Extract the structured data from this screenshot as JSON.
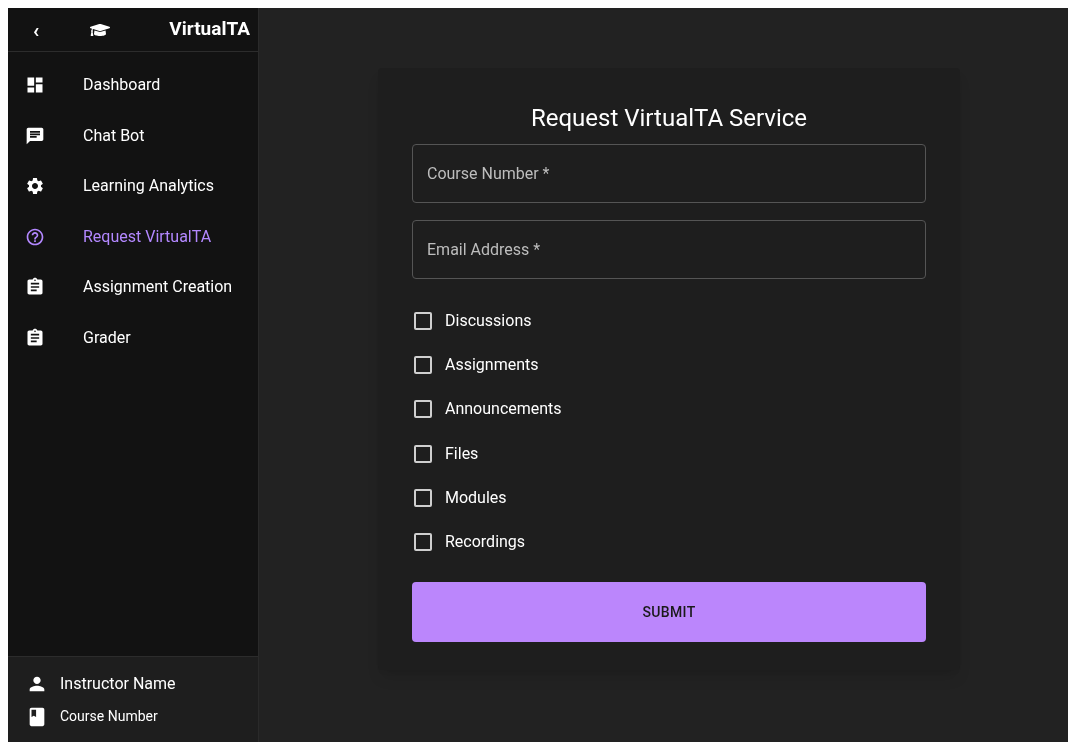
{
  "sidebar": {
    "collapse_button": "‹",
    "brand": "VirtualTA",
    "items": [
      {
        "label": "Dashboard",
        "selected": false
      },
      {
        "label": "Chat Bot",
        "selected": false
      },
      {
        "label": "Learning Analytics",
        "selected": false
      },
      {
        "label": "Request VirtualTA",
        "selected": true
      },
      {
        "label": "Assignment Creation",
        "selected": false
      },
      {
        "label": "Grader",
        "selected": false
      }
    ],
    "footer": {
      "user": "Instructor Name",
      "course": "Course Number"
    }
  },
  "form": {
    "title": "Request VirtualTA Service",
    "fields": [
      {
        "placeholder": "Course Number *"
      },
      {
        "placeholder": "Email Address *"
      }
    ],
    "options": [
      {
        "label": "Discussions",
        "checked": false
      },
      {
        "label": "Assignments",
        "checked": false
      },
      {
        "label": "Announcements",
        "checked": false
      },
      {
        "label": "Files",
        "checked": false
      },
      {
        "label": "Modules",
        "checked": false
      },
      {
        "label": "Recordings",
        "checked": false
      }
    ],
    "submit": "SUBMIT"
  }
}
